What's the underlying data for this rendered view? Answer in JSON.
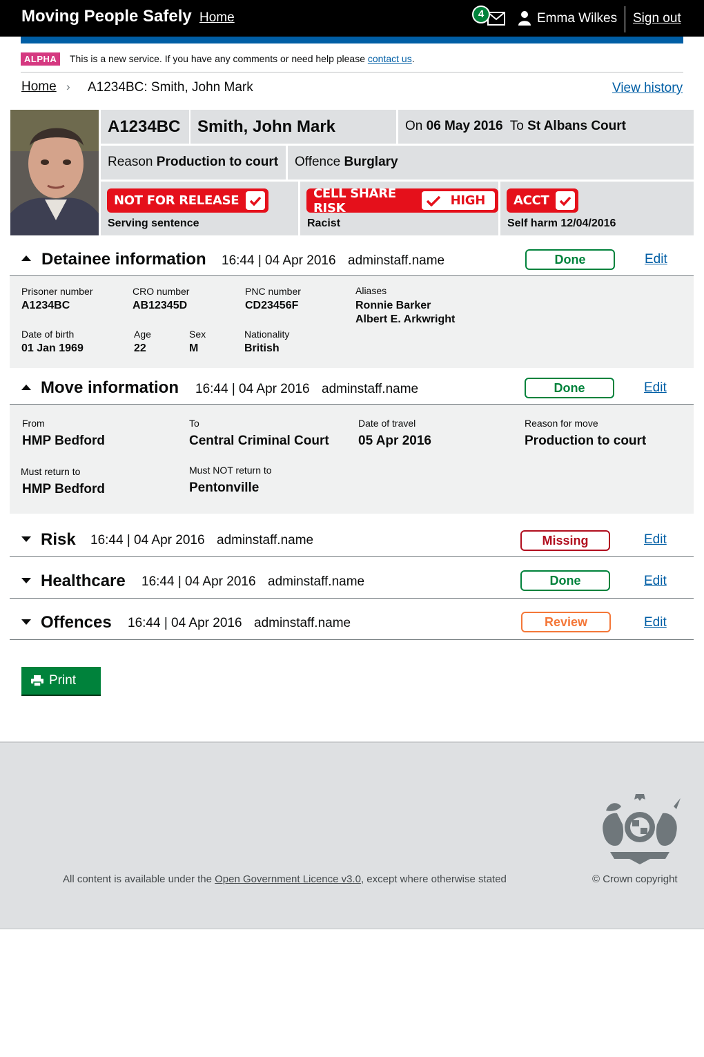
{
  "header": {
    "service_name": "Moving People Safely",
    "home_link": "Home",
    "message_count": "4",
    "user_name": "Emma Wilkes",
    "sign_out": "Sign out"
  },
  "banner": {
    "tag": "ALPHA",
    "text": "This is a new service. If you have any comments or need help please ",
    "link": "contact us",
    "suffix": "."
  },
  "breadcrumb": {
    "home": "Home",
    "separator": "›",
    "current": "A1234BC: Smith, John Mark",
    "view_history": "View history"
  },
  "summary": {
    "prisoner_id": "A1234BC",
    "name": "Smith, John Mark",
    "on_label": "On",
    "date": "06 May 2016",
    "to_label": "To",
    "destination": "St Albans Court",
    "reason_label": "Reason",
    "reason": "Production to court",
    "offence_label": "Offence",
    "offence": "Burglary",
    "alerts": [
      {
        "label": "NOT FOR RELEASE",
        "sub": "Serving sentence"
      },
      {
        "label": "CELL SHARE RISK",
        "level": "HIGH",
        "sub": "Racist"
      },
      {
        "label": "ACCT",
        "sub": "Self harm 12/04/2016"
      }
    ]
  },
  "sections": [
    {
      "title": "Detainee information",
      "time": "16:44 | 04 Apr 2016",
      "user": "adminstaff.name",
      "status": "Done",
      "edit": "Edit",
      "expanded": true
    },
    {
      "title": "Move information",
      "time": "16:44 | 04 Apr 2016",
      "user": "adminstaff.name",
      "status": "Done",
      "edit": "Edit",
      "expanded": true
    },
    {
      "title": "Risk",
      "time": "16:44 | 04 Apr 2016",
      "user": "adminstaff.name",
      "status": "Missing",
      "edit": "Edit",
      "expanded": false
    },
    {
      "title": "Healthcare",
      "time": "16:44 | 04 Apr 2016",
      "user": "adminstaff.name",
      "status": "Done",
      "edit": "Edit",
      "expanded": false
    },
    {
      "title": "Offences",
      "time": "16:44 | 04 Apr 2016",
      "user": "adminstaff.name",
      "status": "Review",
      "edit": "Edit",
      "expanded": false
    }
  ],
  "detainee": {
    "prisoner_number_label": "Prisoner number",
    "prisoner_number": "A1234BC",
    "cro_label": "CRO number",
    "cro": "AB12345D",
    "pnc_label": "PNC number",
    "pnc": "CD23456F",
    "aliases_label": "Aliases",
    "aliases": [
      "Ronnie Barker",
      "Albert E. Arkwright"
    ],
    "dob_label": "Date of birth",
    "dob": "01 Jan 1969",
    "age_label": "Age",
    "age": "22",
    "sex_label": "Sex",
    "sex": "M",
    "nationality_label": "Nationality",
    "nationality": "British"
  },
  "move": {
    "from_label": "From",
    "from": "HMP Bedford",
    "to_label": "To",
    "to": "Central Criminal Court",
    "travel_label": "Date of travel",
    "travel": "05 Apr 2016",
    "reason_label": "Reason for move",
    "reason": "Production to court",
    "return_label": "Must return to",
    "return": "HMP Bedford",
    "not_return_label": "Must NOT return to",
    "not_return": "Pentonville"
  },
  "print_label": "Print",
  "footer": {
    "licence_prefix": "All content is available under the ",
    "licence_link": "Open Government Licence v3.0",
    "licence_suffix": ", except where otherwise stated",
    "copyright": "© Crown copyright"
  },
  "colors": {
    "header_bg": "#000000",
    "accent_blue": "#005ea5",
    "alpha": "#d53880",
    "alert_red": "#e5101b",
    "done": "#00823b",
    "missing": "#b10e1e",
    "review": "#f47738"
  }
}
